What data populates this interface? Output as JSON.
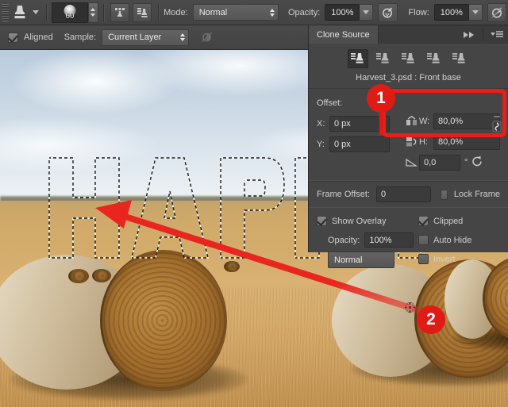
{
  "app": {
    "tool": "Clone Stamp Tool",
    "accent_red": "#e01b16",
    "panel_bg": "#454545",
    "bar_bg": "#474747"
  },
  "options_bar": {
    "brush_size": "60",
    "mode_label": "Mode:",
    "mode_value": "Normal",
    "opacity_label": "Opacity:",
    "opacity_value": "100%",
    "flow_label": "Flow:",
    "flow_value": "100%",
    "icons": {
      "tool": "clone-stamp-icon",
      "tool_preset_caret": "chevron-down-icon",
      "brush_panel": "brush-panel-icon",
      "clone_source_panel": "clone-source-panel-icon",
      "airbrush": "airbrush-icon",
      "tablet_pressure_opacity": "tablet-pressure-opacity-icon",
      "tablet_pressure_size": "tablet-pressure-size-icon"
    }
  },
  "second_bar": {
    "aligned_label": "Aligned",
    "aligned_checked": true,
    "sample_label": "Sample:",
    "sample_value": "Current Layer",
    "ignore_adjustment_icon": "ignore-adjustment-layers-icon"
  },
  "panel": {
    "tab_label": "Clone Source",
    "collapse_icon": "double-chevron-right-icon",
    "menu_icon": "panel-menu-icon",
    "sources": [
      {
        "name": "clone-source-1",
        "selected": true
      },
      {
        "name": "clone-source-2",
        "selected": false
      },
      {
        "name": "clone-source-3",
        "selected": false
      },
      {
        "name": "clone-source-4",
        "selected": false
      },
      {
        "name": "clone-source-5",
        "selected": false
      }
    ],
    "filename": "Harvest_3.psd : Front base",
    "offset_label": "Offset:",
    "x_label": "X:",
    "x_value": "0 px",
    "y_label": "Y:",
    "y_value": "0 px",
    "w_label": "W:",
    "w_value": "80,0%",
    "h_label": "H:",
    "h_value": "80,0%",
    "angle_value": "0,0",
    "degree_symbol": "°",
    "flip_horizontal_icon": "flip-horizontal-icon",
    "flip_vertical_icon": "flip-vertical-icon",
    "link_wh_icon": "link-chain-icon",
    "reset_transform_icon": "reset-transform-icon",
    "frame_offset_label": "Frame Offset:",
    "frame_offset_value": "0",
    "lock_frame_label": "Lock Frame",
    "lock_frame_checked": false,
    "show_overlay_label": "Show Overlay",
    "show_overlay_checked": true,
    "clipped_label": "Clipped",
    "clipped_checked": true,
    "opacity_label": "Opacity:",
    "opacity_value": "100%",
    "auto_hide_label": "Auto Hide",
    "auto_hide_checked": false,
    "blend_mode_value": "Normal",
    "invert_label": "Invert",
    "invert_checked": false
  },
  "annotations": {
    "badge_one": "1",
    "badge_two": "2",
    "highlight_color": "#ee1c16",
    "arrow_color": "#e8261f",
    "cursor_icon": "clone-source-crosshair-icon"
  },
  "canvas": {
    "image_description": "Field with round straw bales under a cloudy sky",
    "selection_text": "HAPPY"
  }
}
